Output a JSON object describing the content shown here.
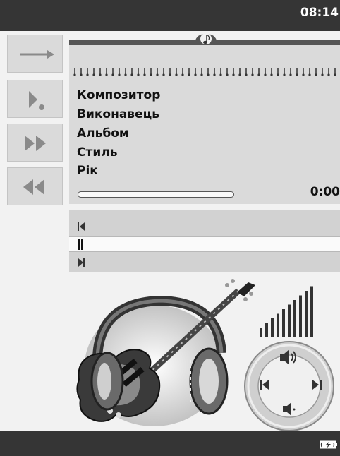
{
  "status_bar": {
    "time": "08:14"
  },
  "track_info": {
    "composer_label": "Композитор",
    "performer_label": "Виконавець",
    "album_label": "Альбом",
    "style_label": "Стиль",
    "year_label": "Рік",
    "elapsed_time": "0:00",
    "progress": 0
  },
  "side_buttons": [
    {
      "icon": "arrow-right-icon"
    },
    {
      "icon": "play-step-icon"
    },
    {
      "icon": "fast-forward-icon"
    },
    {
      "icon": "rewind-icon"
    }
  ],
  "playlist_controls": [
    {
      "icon": "skip-previous-icon"
    },
    {
      "icon": "pause-icon"
    },
    {
      "icon": "skip-next-icon"
    }
  ],
  "volume": {
    "bars": 10
  },
  "colors": {
    "bar_dark": "#353535",
    "panel": "#dadada",
    "accent": "#555555"
  }
}
